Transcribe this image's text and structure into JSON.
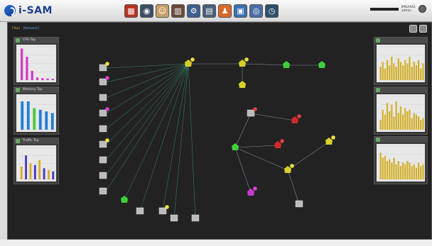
{
  "app": {
    "logo_text": "i-SAM",
    "logo_sub": "",
    "user_line1": "IMSAAS1",
    "user_line2": "admin"
  },
  "toolbar_icons": [
    {
      "name": "network-map-icon",
      "color": "#b8321f",
      "glyph": "▦"
    },
    {
      "name": "monitor-icon",
      "color": "#3f4d63",
      "glyph": "◉"
    },
    {
      "name": "face-icon",
      "color": "#c9a06a",
      "glyph": "☺"
    },
    {
      "name": "server-icon",
      "color": "#6a4a3a",
      "glyph": "▥"
    },
    {
      "name": "settings-icon",
      "color": "#3d5f8f",
      "glyph": "⚙"
    },
    {
      "name": "storage-icon",
      "color": "#4a5f7a",
      "glyph": "▤"
    },
    {
      "name": "user-icon",
      "color": "#d86a2a",
      "glyph": "♟"
    },
    {
      "name": "report-icon",
      "color": "#3a6fb0",
      "glyph": "▣"
    },
    {
      "name": "globe-icon",
      "color": "#4a6fa8",
      "glyph": "◎"
    },
    {
      "name": "clock-icon",
      "color": "#2f4f6a",
      "glyph": "◷"
    }
  ],
  "breadcrumb": {
    "prefix": "[Top]",
    "path": "[Network]"
  },
  "left_panels": [
    {
      "title": "CPU Top",
      "chart_data": {
        "type": "bar",
        "values": [
          95,
          70,
          28,
          8,
          6,
          5,
          4
        ],
        "colors": [
          "#d43ac8",
          "#d43ac8",
          "#d43ac8",
          "#d43ac8",
          "#d43ac8",
          "#d43ac8",
          "#d43ac8"
        ]
      }
    },
    {
      "title": "Memory Top",
      "chart_data": {
        "type": "bar",
        "values": [
          85,
          85,
          65,
          60,
          55,
          50
        ],
        "colors": [
          "#1f7fd4",
          "#1f7fd4",
          "#4cc83a",
          "#1f7fd4",
          "#1f7fd4",
          "#1f7fd4"
        ]
      }
    },
    {
      "title": "Traffic Top",
      "chart_data": {
        "type": "bar",
        "values": [
          40,
          75,
          50,
          45,
          60,
          35,
          30,
          25
        ],
        "colors": [
          "#d4b02a",
          "#4a3ac8",
          "#d4b02a",
          "#4a3ac8",
          "#d4b02a",
          "#4a3ac8",
          "#d4b02a",
          "#4a3ac8"
        ]
      }
    }
  ],
  "right_panels": [
    {
      "title": "",
      "chart_data": {
        "type": "bar",
        "values": [
          40,
          55,
          35,
          60,
          45,
          70,
          50,
          40,
          65,
          55,
          45,
          60,
          50,
          70,
          40,
          55,
          45,
          60,
          35,
          50
        ]
      }
    },
    {
      "title": "",
      "chart_data": {
        "type": "bar",
        "values": [
          30,
          60,
          45,
          80,
          55,
          75,
          40,
          85,
          50,
          70,
          45,
          65,
          55,
          60,
          35,
          50,
          45,
          40,
          30,
          35
        ]
      }
    },
    {
      "title": "",
      "chart_data": {
        "type": "bar",
        "values": [
          80,
          65,
          70,
          55,
          60,
          50,
          65,
          45,
          55,
          40,
          50,
          45,
          55,
          50,
          40,
          45,
          35,
          50,
          40,
          45
        ]
      }
    }
  ],
  "topology": {
    "hub_label": "",
    "nodes": [
      {
        "id": "hub",
        "label": "",
        "color": "#d8d02a",
        "kind": "router",
        "badge": "yellow"
      },
      {
        "id": "n1",
        "label": "",
        "color": "#d8d02a",
        "kind": "router",
        "badge": "yellow"
      },
      {
        "id": "n2",
        "label": "",
        "color": "#3fcf3a",
        "kind": "router",
        "badge": ""
      },
      {
        "id": "n3",
        "label": "",
        "color": "#3fcf3a",
        "kind": "router",
        "badge": ""
      },
      {
        "id": "n4",
        "label": "",
        "color": "#d8d02a",
        "kind": "router",
        "badge": ""
      },
      {
        "id": "n5",
        "label": "",
        "color": "#bbb",
        "kind": "server",
        "badge": "red"
      },
      {
        "id": "n6",
        "label": "",
        "color": "#cf2a2a",
        "kind": "router",
        "badge": "red"
      },
      {
        "id": "n7",
        "label": "",
        "color": "#3fcf3a",
        "kind": "router",
        "badge": ""
      },
      {
        "id": "n8",
        "label": "",
        "color": "#cf2a2a",
        "kind": "router",
        "badge": "red"
      },
      {
        "id": "n9",
        "label": "",
        "color": "#d8d02a",
        "kind": "router",
        "badge": "yellow"
      },
      {
        "id": "n10",
        "label": "",
        "color": "#d8d02a",
        "kind": "router",
        "badge": "yellow"
      },
      {
        "id": "n11",
        "label": "",
        "color": "#c83ac8",
        "kind": "router",
        "badge": "magenta"
      },
      {
        "id": "n12",
        "label": "",
        "color": "#bbb",
        "kind": "server",
        "badge": ""
      },
      {
        "id": "n13",
        "label": "",
        "color": "#3fcf3a",
        "kind": "router",
        "badge": ""
      },
      {
        "id": "n14",
        "label": "",
        "color": "#bbb",
        "kind": "server",
        "badge": ""
      },
      {
        "id": "n15",
        "label": "",
        "color": "#bbb",
        "kind": "server",
        "badge": "yellow"
      },
      {
        "id": "n16",
        "label": "",
        "color": "#bbb",
        "kind": "server",
        "badge": ""
      },
      {
        "id": "n17",
        "label": "",
        "color": "#bbb",
        "kind": "server",
        "badge": ""
      }
    ],
    "left_devices": [
      {
        "label": "",
        "badge": "yellow"
      },
      {
        "label": "",
        "badge": "magenta"
      },
      {
        "label": "",
        "badge": ""
      },
      {
        "label": "",
        "badge": "magenta"
      },
      {
        "label": "",
        "badge": ""
      },
      {
        "label": "",
        "badge": "yellow"
      },
      {
        "label": "",
        "badge": ""
      },
      {
        "label": "",
        "badge": ""
      },
      {
        "label": "",
        "badge": ""
      }
    ]
  }
}
